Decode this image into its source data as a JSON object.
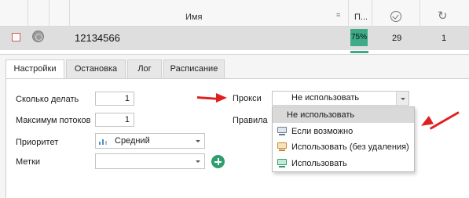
{
  "grid": {
    "header": {
      "name": "Имя",
      "progress": "П...",
      "success_icon": "check-circle-icon",
      "repeat_icon": "refresh-icon"
    },
    "row": {
      "name": "12134566",
      "progress_text": "75%",
      "progress_fraction": 0.75,
      "success_count": "29",
      "repeat_count": "1"
    }
  },
  "tabs": [
    {
      "label": "Настройки",
      "active": true
    },
    {
      "label": "Остановка",
      "active": false
    },
    {
      "label": "Лог",
      "active": false
    },
    {
      "label": "Расписание",
      "active": false
    }
  ],
  "form": {
    "how_many_label": "Сколько делать",
    "how_many_value": "1",
    "max_threads_label": "Максимум потоков",
    "max_threads_value": "1",
    "priority_label": "Приоритет",
    "priority_value": "Средний",
    "tags_label": "Метки",
    "tags_value": "",
    "proxy_label": "Прокси",
    "proxy_value": "Не использовать",
    "rules_label": "Правила"
  },
  "proxy_dropdown": {
    "options": [
      {
        "label": "Не использовать",
        "icon": "none",
        "selected": true
      },
      {
        "label": "Если возможно",
        "icon": "monitor-icon"
      },
      {
        "label": "Использовать (без удаления)",
        "icon": "monitor-orange-icon"
      },
      {
        "label": "Использовать",
        "icon": "monitor-green-icon"
      }
    ]
  },
  "colors": {
    "accent_green": "#3daa88",
    "add_button": "#2e9e6e",
    "annotation_arrow": "#e02020",
    "checkbox_red": "#d9534f"
  }
}
